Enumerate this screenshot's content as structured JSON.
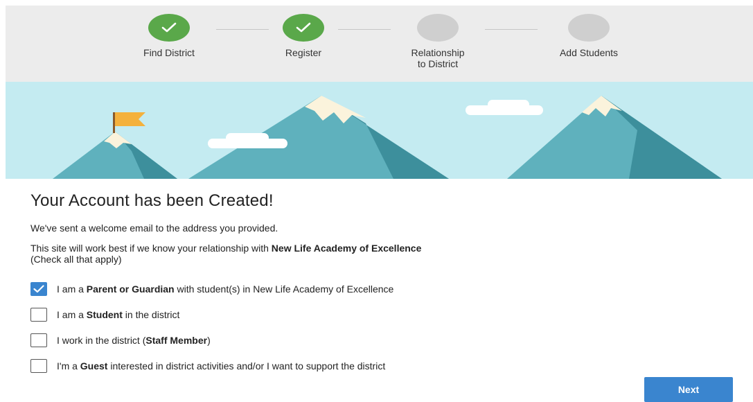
{
  "stepper": {
    "steps": [
      {
        "label": "Find District",
        "status": "done"
      },
      {
        "label": "Register",
        "status": "done"
      },
      {
        "label": "Relationship\nto District",
        "label_line1": "Relationship",
        "label_line2": "to District",
        "status": "pending"
      },
      {
        "label": "Add Students",
        "status": "pending"
      }
    ],
    "done_color": "#5aa84a",
    "pending_color": "#cfcfcf"
  },
  "banner": {
    "sky_color": "#c4ebf1",
    "mountain_color": "#5fb1bd",
    "mountain_shadow_color": "#3d8f9c",
    "flag_color": "#f4b13c"
  },
  "content": {
    "title": "Your Account has been Created!",
    "welcome_text": "We've sent a welcome email to the address you provided.",
    "relationship_prefix": "This site will work best if we know your relationship with ",
    "district_name": "New Life Academy of Excellence",
    "check_hint": "(Check all that apply)",
    "options": [
      {
        "checked": true,
        "pre": "I am a ",
        "bold": "Parent or Guardian",
        "post": " with student(s) in New Life Academy of Excellence"
      },
      {
        "checked": false,
        "pre": "I am a ",
        "bold": "Student",
        "post": " in the district"
      },
      {
        "checked": false,
        "pre": "I work in the district (",
        "bold": "Staff Member",
        "post": ")"
      },
      {
        "checked": false,
        "pre": "I'm a ",
        "bold": "Guest",
        "post": " interested in district activities and/or I want to support the district"
      }
    ]
  },
  "actions": {
    "next_label": "Next",
    "accent_color": "#3a85cf"
  }
}
